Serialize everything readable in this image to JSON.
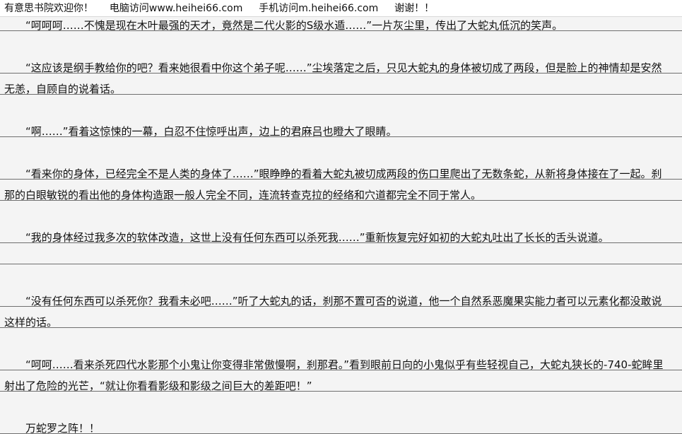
{
  "header": {
    "site_name": "有意思书院欢迎你！",
    "pc_label": "电脑访问",
    "pc_url": "www.heihei66.com",
    "mobile_label": "手机访问",
    "mobile_url": "m.heihei66.com",
    "thanks": "谢谢！！"
  },
  "paragraphs": [
    "　　“呵呵呵……不愧是现在木叶最强的天才，竟然是二代火影的S级水遁……”一片灰尘里，传出了大蛇丸低沉的笑声。",
    "　　“这应该是纲手教给你的吧？看来她很看中你这个弟子呢……”尘埃落定之后，只见大蛇丸的身体被切成了两段，但是脸上的神情却是安然无恙，自顾自的说着话。",
    "　　“啊……”看着这惊悚的一幕，白忍不住惊呼出声，边上的君麻吕也瞪大了眼睛。",
    "　　“看来你的身体，已经完全不是人类的身体了……”眼睁睁的看着大蛇丸被切成两段的伤口里爬出了无数条蛇，从新将身体接在了一起。刹那的白眼敏锐的看出他的身体构造跟一般人完全不同，连流转查克拉的经络和穴道都完全不同于常人。",
    "　　“我的身体经过我多次的软体改造，这世上没有任何东西可以杀死我……”重新恢复完好如初的大蛇丸吐出了长长的舌头说道。",
    "　　“没有任何东西可以杀死你？我看未必吧……”听了大蛇丸的话，刹那不置可否的说道，他一个自然系恶魔果实能力者可以元素化都没敢说这样的话。",
    "　　“呵呵……看来杀死四代水影那个小鬼让你变得非常傲慢啊，刹那君。”看到眼前日向的小鬼似乎有些轻视自己，大蛇丸狭长的-740-蛇眸里射出了危险的光芒，“就让你看看影级和影级之间巨大的差距吧！”",
    "　　万蛇罗之阵！！"
  ]
}
